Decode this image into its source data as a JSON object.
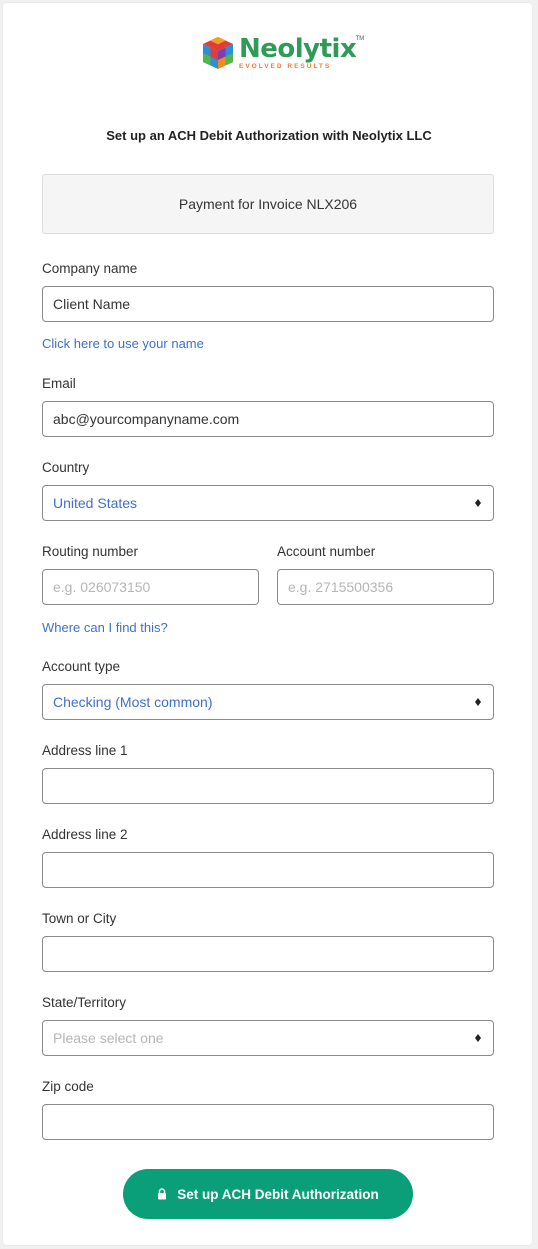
{
  "brand": {
    "name": "Neolytix",
    "trademark": "TM",
    "tagline": "EVOLVED RESULTS",
    "colors": {
      "green": "#2e9b57",
      "orange": "#f07a30"
    }
  },
  "heading": "Set up an ACH Debit Authorization with Neolytix LLC",
  "invoice_description": "Payment for Invoice NLX206",
  "form": {
    "company_name": {
      "label": "Company name",
      "value": "Client Name"
    },
    "use_your_name_link": "Click here to use your name",
    "email": {
      "label": "Email",
      "value": "abc@yourcompanyname.com"
    },
    "country": {
      "label": "Country",
      "selected": "United States"
    },
    "routing_number": {
      "label": "Routing number",
      "placeholder": "e.g. 026073150",
      "value": ""
    },
    "account_number": {
      "label": "Account number",
      "placeholder": "e.g. 2715500356",
      "value": ""
    },
    "find_this_link": "Where can I find this?",
    "account_type": {
      "label": "Account type",
      "selected": "Checking (Most common)"
    },
    "address_line_1": {
      "label": "Address line 1",
      "value": ""
    },
    "address_line_2": {
      "label": "Address line 2",
      "value": ""
    },
    "town_city": {
      "label": "Town or City",
      "value": ""
    },
    "state": {
      "label": "State/Territory",
      "placeholder": "Please select one"
    },
    "zip_code": {
      "label": "Zip code",
      "value": ""
    }
  },
  "submit": {
    "label": "Set up ACH Debit Authorization",
    "icon": "lock-icon",
    "color": "#0a9f78"
  },
  "colors": {
    "link": "#3f70c8",
    "border": "#8a8a8a"
  }
}
